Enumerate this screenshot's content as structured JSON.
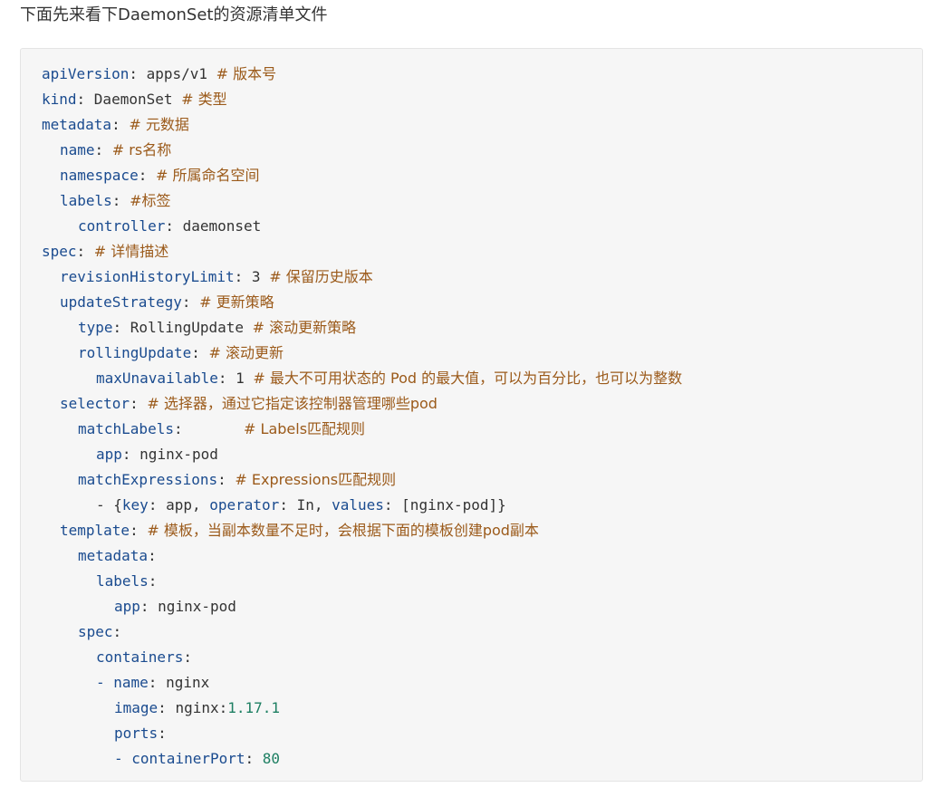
{
  "intro": "下面先来看下DaemonSet的资源清单文件",
  "code": {
    "apiVersion_key": "apiVersion",
    "apiVersion_val": "apps/v1",
    "apiVersion_comment": "# 版本号",
    "kind_key": "kind",
    "kind_val": "DaemonSet",
    "kind_comment": "# 类型",
    "metadata_key": "metadata",
    "metadata_comment": "# 元数据",
    "name_key": "name",
    "name_comment": "# rs名称",
    "namespace_key": "namespace",
    "namespace_comment": "# 所属命名空间",
    "labels_key": "labels",
    "labels_comment": "#标签",
    "controller_key": "controller",
    "controller_val": "daemonset",
    "spec_key": "spec",
    "spec_comment": "# 详情描述",
    "rhl_key": "revisionHistoryLimit",
    "rhl_val": "3",
    "rhl_comment": "# 保留历史版本",
    "us_key": "updateStrategy",
    "us_comment": "# 更新策略",
    "type_key": "type",
    "type_val": "RollingUpdate",
    "type_comment": "# 滚动更新策略",
    "ru_key": "rollingUpdate",
    "ru_comment": "# 滚动更新",
    "mu_key": "maxUnavailable",
    "mu_val": "1",
    "mu_comment": "# 最大不可用状态的 Pod 的最大值，可以为百分比，也可以为整数",
    "selector_key": "selector",
    "selector_comment": "# 选择器，通过它指定该控制器管理哪些pod",
    "ml_key": "matchLabels",
    "ml_gap": "      ",
    "ml_comment": "# Labels匹配规则",
    "app_key": "app",
    "app_val": "nginx-pod",
    "me_key": "matchExpressions",
    "me_comment": "# Expressions匹配规则",
    "expr_dash": "- {",
    "expr_key1": "key",
    "expr_val1": "app",
    "expr_key2": "operator",
    "expr_val2": "In",
    "expr_key3": "values",
    "expr_val3": "[nginx-pod]}",
    "template_key": "template",
    "template_comment": "# 模板，当副本数量不足时，会根据下面的模板创建pod副本",
    "tmeta_key": "metadata",
    "tlabels_key": "labels",
    "tapp_key": "app",
    "tapp_val": "nginx-pod",
    "tspec_key": "spec",
    "containers_key": "containers",
    "cname_dash": "- ",
    "cname_key": "name",
    "cname_val": "nginx",
    "image_key": "image",
    "image_val": "nginx:",
    "image_ver": "1.17.1",
    "ports_key": "ports",
    "cport_dash": "- ",
    "cport_key": "containerPort",
    "cport_val": "80"
  }
}
